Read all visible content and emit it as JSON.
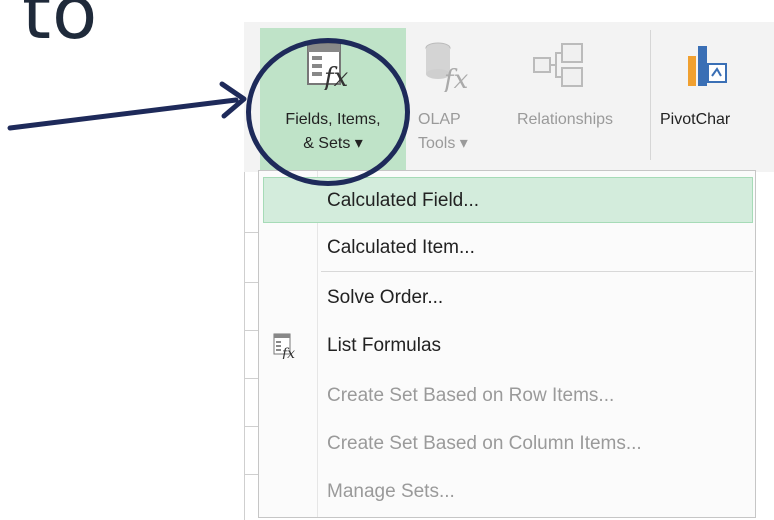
{
  "slide": {
    "word": "to"
  },
  "ribbon": {
    "fields_items_sets": {
      "line1": "Fields, Items,",
      "line2": "& Sets ▾"
    },
    "olap_tools": {
      "line1": "OLAP",
      "line2": "Tools ▾"
    },
    "relationships": {
      "label": "Relationships"
    },
    "pivotchart": {
      "label": "PivotChar"
    }
  },
  "menu": {
    "items": [
      {
        "label": "Calculated Field...",
        "enabled": true,
        "highlighted": true
      },
      {
        "label": "Calculated Item...",
        "enabled": true
      },
      {
        "label": "Solve Order...",
        "enabled": true
      },
      {
        "label": "List Formulas",
        "enabled": true,
        "icon": "list-formulas-icon"
      },
      {
        "label": "Create Set Based on Row Items...",
        "enabled": false
      },
      {
        "label": "Create Set Based on Column Items...",
        "enabled": false
      },
      {
        "label": "Manage Sets...",
        "enabled": false
      }
    ]
  },
  "colors": {
    "highlight": "#d3ecdc",
    "annotation": "#1e2a5a",
    "ribbon_active": "#bfe3c8"
  }
}
